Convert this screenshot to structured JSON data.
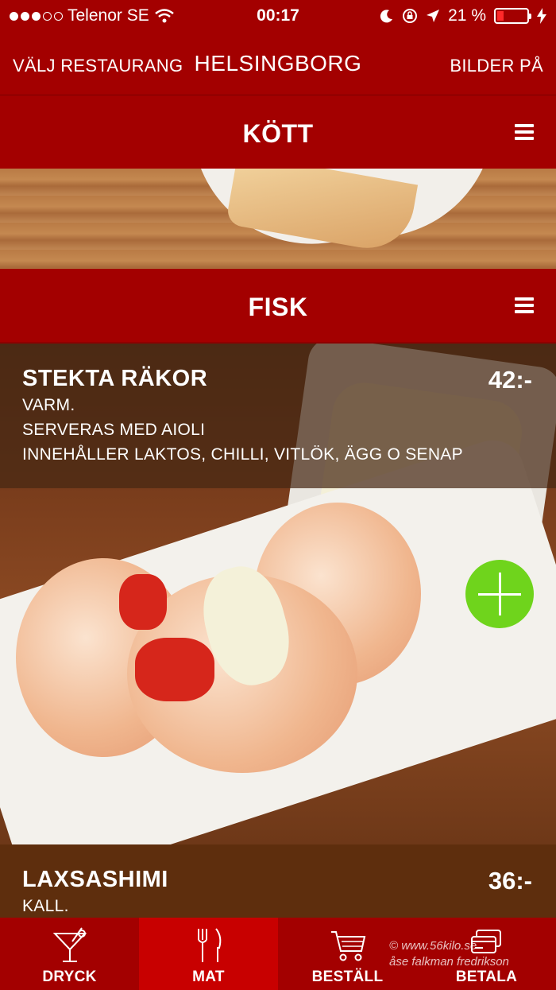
{
  "status_bar": {
    "carrier": "Telenor SE",
    "time": "00:17",
    "battery": "21 %",
    "battery_level": 0.21
  },
  "nav": {
    "left": "VÄLJ RESTAURANG",
    "title": "HELSINGBORG",
    "right": "BILDER PÅ"
  },
  "sections": [
    {
      "title": "KÖTT"
    },
    {
      "title": "FISK"
    }
  ],
  "items": [
    {
      "name": "STEKTA RÄKOR",
      "price": "42:-",
      "desc": [
        "VARM.",
        "SERVERAS MED AIOLI",
        "INNEHÅLLER LAKTOS, CHILLI, VITLÖK, ÄGG O SENAP"
      ]
    },
    {
      "name": "LAXSASHIMI",
      "price": "36:-",
      "desc": [
        "KALL."
      ]
    }
  ],
  "tabs": [
    {
      "label": "DRYCK",
      "icon": "cocktail-icon"
    },
    {
      "label": "MAT",
      "icon": "cutlery-icon",
      "active": true
    },
    {
      "label": "BESTÄLL",
      "icon": "cart-icon"
    },
    {
      "label": "BETALA",
      "icon": "credit-card-icon"
    }
  ],
  "watermark": {
    "line1": "© www.56kilo.se",
    "line2": "åse falkman fredrikson"
  },
  "colors": {
    "brand_red": "#a30000",
    "active_tab": "#c80000",
    "add_green": "#6fd41c"
  }
}
